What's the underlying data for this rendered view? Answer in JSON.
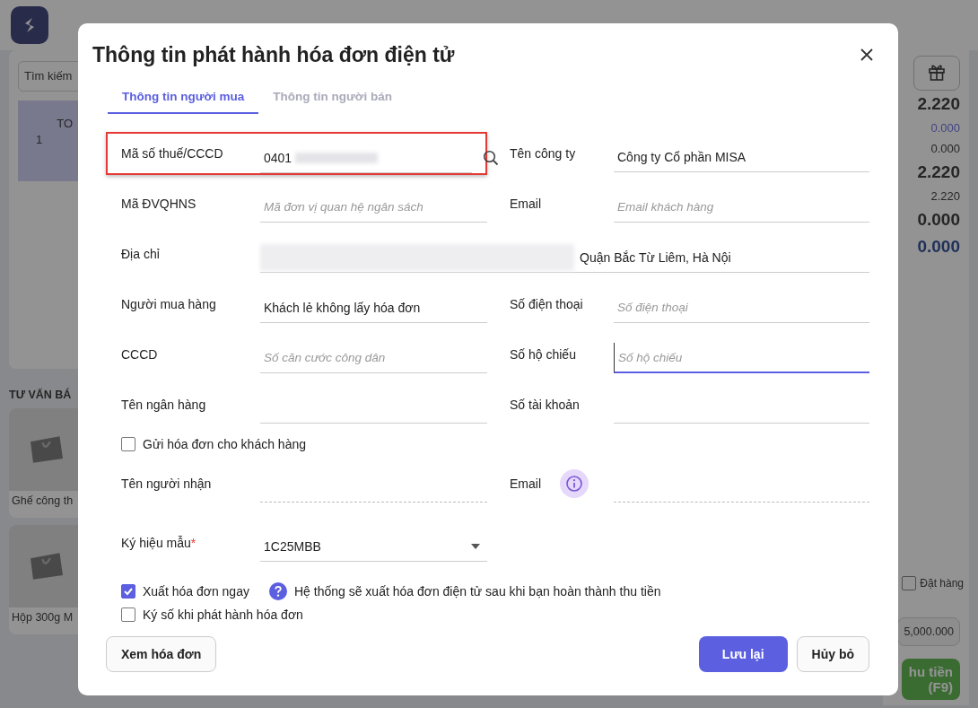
{
  "background": {
    "search_placeholder": "Tìm kiếm",
    "order_row": {
      "index": "1",
      "column_label": "TO"
    },
    "section_title": "TƯ VẤN BÁ",
    "products": [
      {
        "name": "Ghế công th"
      },
      {
        "name": "Hộp 300g M"
      }
    ],
    "totals": [
      {
        "value": "2.220",
        "kind": "big"
      },
      {
        "value": "0.000",
        "kind": "link"
      },
      {
        "value": "0.000",
        "kind": "small"
      },
      {
        "value": "2.220",
        "kind": "big"
      },
      {
        "value": "2.220",
        "kind": "small"
      },
      {
        "value": "0.000",
        "kind": "big"
      },
      {
        "value": "0.000",
        "kind": "accent"
      }
    ],
    "order_checkbox": {
      "label": "Đặt hàng",
      "checked": false
    },
    "amount": "5,000.000",
    "pay_button": [
      "hu tiền",
      "(F9)"
    ]
  },
  "dialog": {
    "title": "Thông tin phát hành hóa đơn điện tử",
    "tabs": [
      {
        "label": "Thông tin người mua",
        "selected": true
      },
      {
        "label": "Thông tin người bán",
        "selected": false
      }
    ],
    "fields": [
      {
        "label": "Mã số thuế/CCCD",
        "value": "0401",
        "redacted": true,
        "highlighted": true,
        "focused": false,
        "kind": "search"
      },
      {
        "label": "Tên công ty",
        "value": "Công ty Cổ phần MISA",
        "focused": false,
        "kind": "text"
      },
      {
        "label": "Mã ĐVQHNS",
        "placeholder": "Mã đơn vị quan hệ ngân sách",
        "focused": false,
        "kind": "text"
      },
      {
        "label": "Email",
        "placeholder": "Email khách hàng",
        "focused": false,
        "kind": "text"
      },
      {
        "label": "Địa chỉ",
        "value": "Quận Bắc Từ Liêm, Hà Nội",
        "redacted": true,
        "focused": false,
        "kind": "wide"
      },
      {
        "label": "Người mua hàng",
        "value": "Khách lẻ không lấy hóa đơn",
        "focused": false,
        "kind": "text"
      },
      {
        "label": "Số điện thoại",
        "placeholder": "Số điện thoại",
        "focused": false,
        "kind": "text"
      },
      {
        "label": "CCCD",
        "placeholder": "Số căn cước công dân",
        "focused": false,
        "kind": "text"
      },
      {
        "label": "Số hộ chiếu",
        "placeholder": "Số hộ chiếu",
        "focused": true,
        "kind": "text"
      },
      {
        "label": "Tên ngân hàng",
        "focused": false,
        "kind": "text"
      },
      {
        "label": "Số tài khoản",
        "focused": false,
        "kind": "text"
      }
    ],
    "send_checkbox": {
      "label": "Gửi hóa đơn cho khách hàng",
      "checked": false
    },
    "recipient_fields": [
      {
        "label": "Tên người nhận",
        "kind": "text"
      },
      {
        "label": "Email",
        "kind": "info"
      }
    ],
    "template": {
      "label": "Ký hiệu mẫu",
      "required_mark": "*",
      "value": "1C25MBB"
    },
    "options": [
      {
        "label": "Xuất hóa đơn ngay",
        "checked": true,
        "hint": "Hệ thống sẽ xuất hóa đơn điện tử sau khi bạn hoàn thành thu tiền"
      },
      {
        "label": "Ký số khi phát hành hóa đơn",
        "checked": false
      }
    ],
    "buttons": [
      {
        "label": "Xem hóa đơn",
        "kind": "secondary"
      },
      {
        "label": "Lưu lại",
        "kind": "primary"
      },
      {
        "label": "Hủy bỏ",
        "kind": "secondary"
      }
    ]
  }
}
